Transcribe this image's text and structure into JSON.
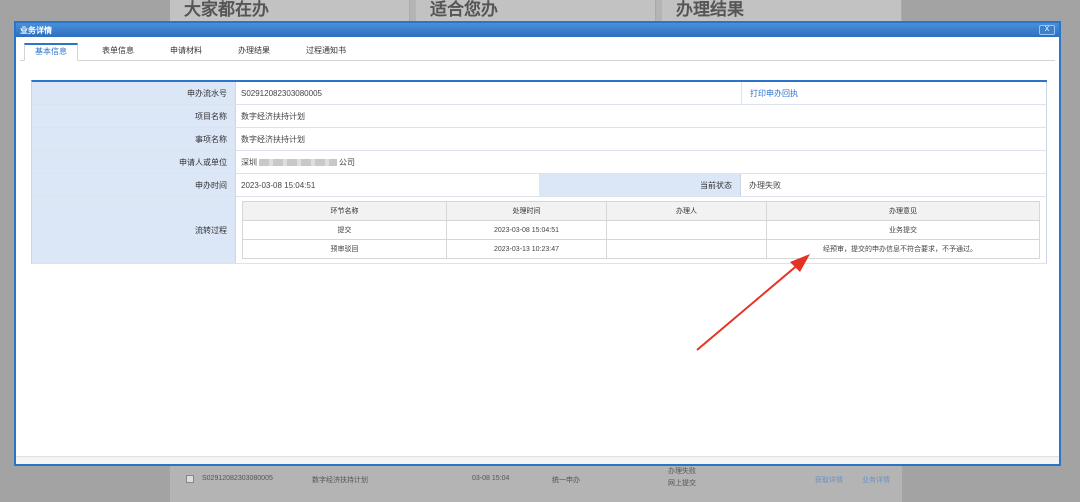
{
  "background": {
    "cards": [
      "大家都在办",
      "适合您办",
      "办理结果"
    ],
    "row": {
      "number": "S02912082303080005",
      "project": "数字经济扶持计划",
      "date": "03-08 15:04",
      "mode": "统一申办",
      "status_line1": "办理失败",
      "status_line2": "网上提交",
      "link1": "获取详情",
      "link2": "业务详情"
    }
  },
  "dialog": {
    "title": "业务详情",
    "close": "X",
    "tabs": [
      "基本信息",
      "表单信息",
      "申请材料",
      "办理结果",
      "过程通知书"
    ],
    "active_tab": 0
  },
  "info": {
    "serial_label": "申办流水号",
    "serial_value": "S02912082303080005",
    "print_link": "打印申办回执",
    "project_label": "项目名称",
    "project_value": "数字经济扶持计划",
    "item_label": "事项名称",
    "item_value": "数字经济扶持计划",
    "applicant_label": "申请人或单位",
    "applicant_prefix": "深圳",
    "applicant_suffix": "公司",
    "time_label": "申办时间",
    "time_value": "2023-03-08 15:04:51",
    "status_label": "当前状态",
    "status_value": "办理失败",
    "flow_label": "流转过程"
  },
  "flow": {
    "headers": [
      "环节名称",
      "处理时间",
      "办理人",
      "办理意见"
    ],
    "rows": [
      [
        "提交",
        "2023-03-08 15:04:51",
        "",
        "业务提交"
      ],
      [
        "预审驳回",
        "2023-03-13 10:23:47",
        "",
        "经预审，提交的申办信息不符合要求，不予通过。"
      ]
    ]
  },
  "colors": {
    "accent": "#2c74c9",
    "label_bg": "#dbe6f6",
    "arrow": "#e53323"
  }
}
